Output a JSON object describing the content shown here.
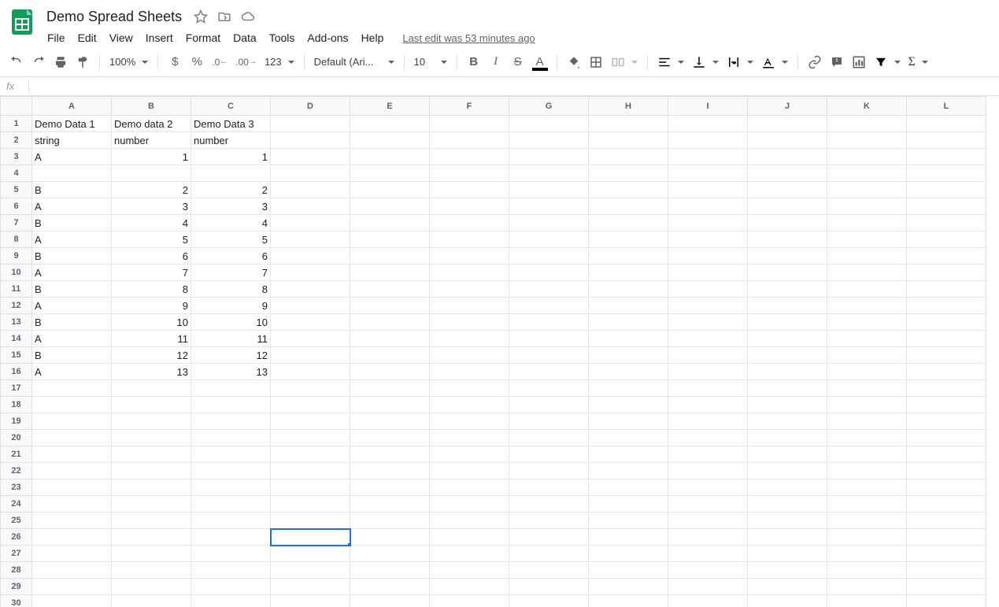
{
  "doc": {
    "title": "Demo Spread Sheets",
    "last_edit": "Last edit was 53 minutes ago"
  },
  "menus": [
    "File",
    "Edit",
    "View",
    "Insert",
    "Format",
    "Data",
    "Tools",
    "Add-ons",
    "Help"
  ],
  "toolbar": {
    "zoom": "100%",
    "more_formats": "123",
    "font": "Default (Ari...",
    "font_size": "10"
  },
  "formula_bar": {
    "fx": "fx",
    "value": ""
  },
  "columns": [
    "A",
    "B",
    "C",
    "D",
    "E",
    "F",
    "G",
    "H",
    "I",
    "J",
    "K",
    "L"
  ],
  "row_count": 30,
  "selected": {
    "row": 26,
    "col": 3
  },
  "cells": {
    "1": {
      "A": {
        "v": "Demo Data 1",
        "t": "txt"
      },
      "B": {
        "v": "Demo data 2",
        "t": "txt"
      },
      "C": {
        "v": "Demo Data 3",
        "t": "txt"
      }
    },
    "2": {
      "A": {
        "v": "string",
        "t": "txt"
      },
      "B": {
        "v": "number",
        "t": "txt"
      },
      "C": {
        "v": "number",
        "t": "txt"
      }
    },
    "3": {
      "A": {
        "v": "A",
        "t": "txt"
      },
      "B": {
        "v": "1",
        "t": "num"
      },
      "C": {
        "v": "1",
        "t": "num"
      }
    },
    "5": {
      "A": {
        "v": "B",
        "t": "txt"
      },
      "B": {
        "v": "2",
        "t": "num"
      },
      "C": {
        "v": "2",
        "t": "num"
      }
    },
    "6": {
      "A": {
        "v": "A",
        "t": "txt"
      },
      "B": {
        "v": "3",
        "t": "num"
      },
      "C": {
        "v": "3",
        "t": "num"
      }
    },
    "7": {
      "A": {
        "v": "B",
        "t": "txt"
      },
      "B": {
        "v": "4",
        "t": "num"
      },
      "C": {
        "v": "4",
        "t": "num"
      }
    },
    "8": {
      "A": {
        "v": "A",
        "t": "txt"
      },
      "B": {
        "v": "5",
        "t": "num"
      },
      "C": {
        "v": "5",
        "t": "num"
      }
    },
    "9": {
      "A": {
        "v": "B",
        "t": "txt"
      },
      "B": {
        "v": "6",
        "t": "num"
      },
      "C": {
        "v": "6",
        "t": "num"
      }
    },
    "10": {
      "A": {
        "v": "A",
        "t": "txt"
      },
      "B": {
        "v": "7",
        "t": "num"
      },
      "C": {
        "v": "7",
        "t": "num"
      }
    },
    "11": {
      "A": {
        "v": "B",
        "t": "txt"
      },
      "B": {
        "v": "8",
        "t": "num"
      },
      "C": {
        "v": "8",
        "t": "num"
      }
    },
    "12": {
      "A": {
        "v": "A",
        "t": "txt"
      },
      "B": {
        "v": "9",
        "t": "num"
      },
      "C": {
        "v": "9",
        "t": "num"
      }
    },
    "13": {
      "A": {
        "v": "B",
        "t": "txt"
      },
      "B": {
        "v": "10",
        "t": "num"
      },
      "C": {
        "v": "10",
        "t": "num"
      }
    },
    "14": {
      "A": {
        "v": "A",
        "t": "txt"
      },
      "B": {
        "v": "11",
        "t": "num"
      },
      "C": {
        "v": "11",
        "t": "num"
      }
    },
    "15": {
      "A": {
        "v": "B",
        "t": "txt"
      },
      "B": {
        "v": "12",
        "t": "num"
      },
      "C": {
        "v": "12",
        "t": "num"
      }
    },
    "16": {
      "A": {
        "v": "A",
        "t": "txt"
      },
      "B": {
        "v": "13",
        "t": "num"
      },
      "C": {
        "v": "13",
        "t": "num"
      }
    }
  }
}
